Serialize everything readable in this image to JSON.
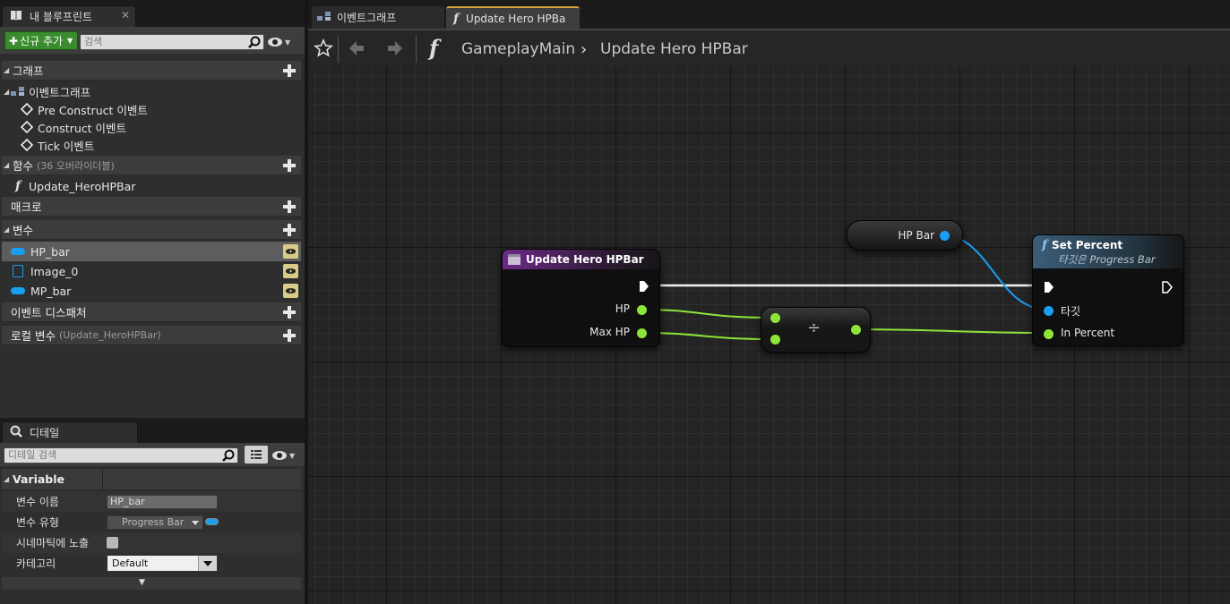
{
  "left_tabs": {
    "blueprint": "내 블루프린트",
    "details": "디테일"
  },
  "toolbar": {
    "add_new_label": "신규 추가",
    "search_placeholder": "검색"
  },
  "sections": {
    "graphs": "그래프",
    "event_graph": "이벤트그래프",
    "event_items": [
      "Pre Construct 이벤트",
      "Construct 이벤트",
      "Tick 이벤트"
    ],
    "functions": "함수",
    "functions_sub": "(36 오버라이더블)",
    "function_items": [
      "Update_HeroHPBar"
    ],
    "macros": "매크로",
    "variables": "변수",
    "variable_items": [
      "HP_bar",
      "Image_0",
      "MP_bar"
    ],
    "dispatchers": "이벤트 디스패처",
    "local_vars": "로컬 변수",
    "local_vars_sub": "(Update_HeroHPBar)"
  },
  "details": {
    "search_placeholder": "디테일 검색",
    "category": "Variable",
    "rows": {
      "name_label": "변수 이름",
      "name_value": "HP_bar",
      "type_label": "변수 유형",
      "type_value": "Progress Bar",
      "cinematic_label": "시네마틱에 노출",
      "category_label": "카테고리",
      "category_value": "Default"
    }
  },
  "graph_tabs": [
    "이벤트그래프",
    "Update Hero HPBa"
  ],
  "breadcrumb": {
    "root": "GameplayMain",
    "current": "Update Hero HPBar"
  },
  "nodes": {
    "hpbar_getter": {
      "pin": "HP Bar"
    },
    "entry": {
      "title": "Update Hero HPBar",
      "pins": [
        "HP",
        "Max HP"
      ]
    },
    "divide": {
      "symbol": "÷"
    },
    "set_percent": {
      "title": "Set Percent",
      "subtitle": "타깃은 Progress Bar",
      "pins": [
        "타깃",
        "In Percent"
      ]
    }
  },
  "colors": {
    "float_pin": "#8ee539",
    "object_pin": "#1a9ef2",
    "func_header": "#6b2a86",
    "setter_header": "#3b5e7a",
    "add_button": "#3a8d2e"
  }
}
